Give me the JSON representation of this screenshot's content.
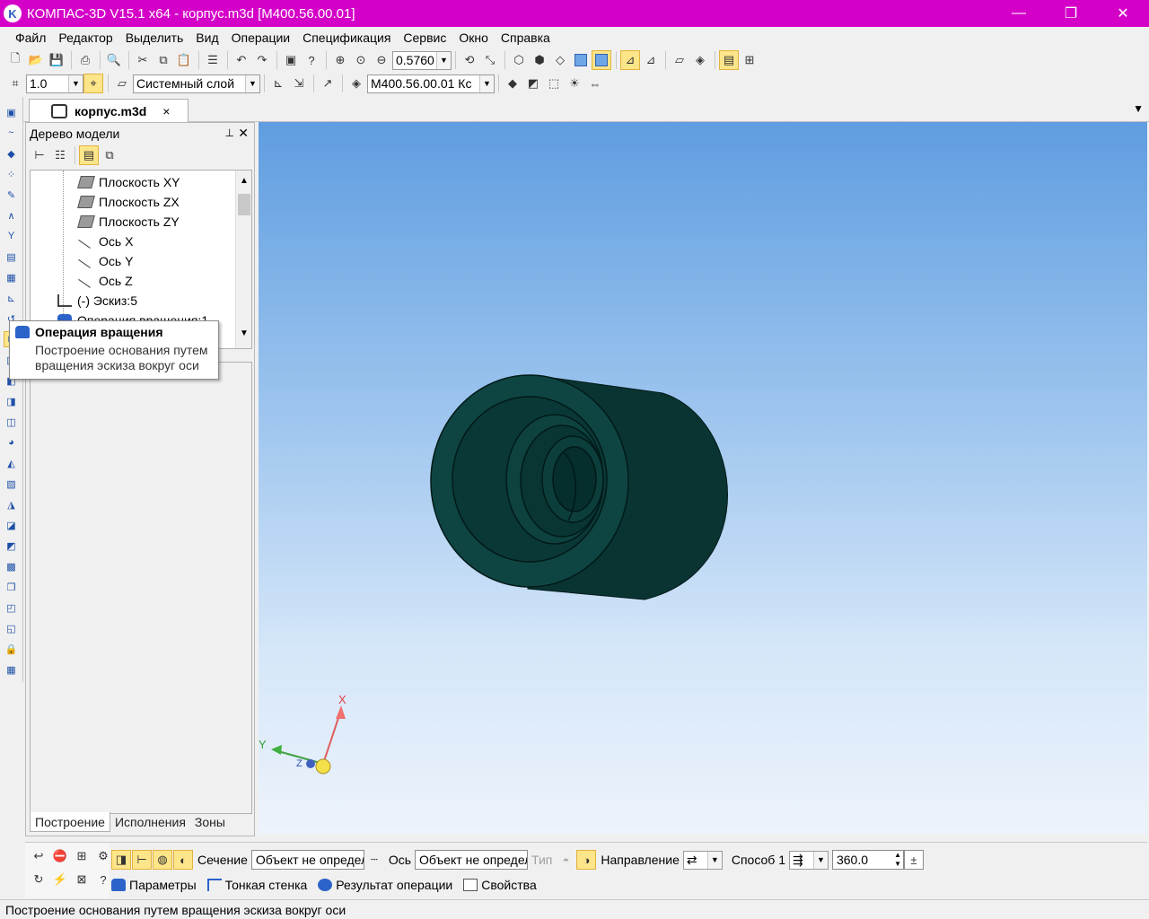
{
  "window": {
    "title": "КОМПАС-3D V15.1 x64 - корпус.m3d [M400.56.00.01]",
    "minimize": "—",
    "maximize": "❐",
    "close": "✕"
  },
  "menu": [
    "Файл",
    "Редактор",
    "Выделить",
    "Вид",
    "Операции",
    "Спецификация",
    "Сервис",
    "Окно",
    "Справка"
  ],
  "toolbar": {
    "zoom_value": "0.5760",
    "step_value": "1.0",
    "layer": "Системный слой",
    "designation": "M400.56.00.01 Кс"
  },
  "doc_tab": {
    "name": "корпус.m3d",
    "close": "×"
  },
  "model_tree": {
    "title": "Дерево модели",
    "pin": "⊥",
    "close": "✕",
    "items": [
      {
        "label": "Плоскость XY",
        "icon": "plane-icon"
      },
      {
        "label": "Плоскость ZX",
        "icon": "plane-icon"
      },
      {
        "label": "Плоскость ZY",
        "icon": "plane-icon"
      },
      {
        "label": "Ось X",
        "icon": "axis-icon"
      },
      {
        "label": "Ось Y",
        "icon": "axis-icon"
      },
      {
        "label": "Ось Z",
        "icon": "axis-icon"
      },
      {
        "label": "(-) Эскиз:5",
        "icon": "sketch-icon"
      },
      {
        "label": "Операция вращения:1",
        "icon": "revolve-icon"
      }
    ],
    "tabs": [
      "Построение",
      "Исполнения",
      "Зоны"
    ]
  },
  "tooltip": {
    "title": "Операция вращения",
    "description_line1": "Построение основания путем",
    "description_line2": "вращения эскиза вокруг оси"
  },
  "triad": {
    "x_label": "X",
    "y_label": "Y",
    "z_label": "Z"
  },
  "property_bar": {
    "section_label": "Сечение",
    "section_value": "Объект не определен",
    "axis_label": "Ось",
    "axis_value": "Объект не определен",
    "type_label": "Тип",
    "direction_label": "Направление",
    "method_label": "Способ 1",
    "angle_value": "360.0",
    "tabs": [
      "Параметры",
      "Тонкая стенка",
      "Результат операции",
      "Свойства"
    ]
  },
  "status": "Построение основания путем вращения эскиза вокруг оси",
  "colors": {
    "titlebar": "#d400c8",
    "model": "#0b3f3c",
    "highlight": "#fde58a"
  }
}
